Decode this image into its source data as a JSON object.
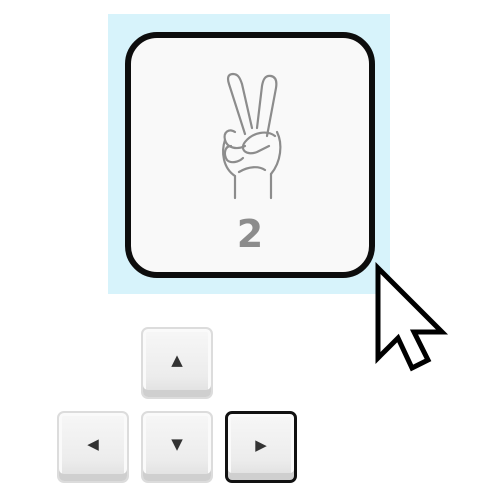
{
  "card": {
    "number": "2",
    "icon": "peace-sign-hand-icon"
  },
  "keys": {
    "up": "▲",
    "left": "◀",
    "down": "▼",
    "right": "▶",
    "active": "right"
  },
  "cursor": {
    "icon": "arrow-cursor-icon"
  },
  "colors": {
    "highlight": "#d7f3fb",
    "card_border": "#0d0d0d",
    "number": "#8c8c8c"
  }
}
